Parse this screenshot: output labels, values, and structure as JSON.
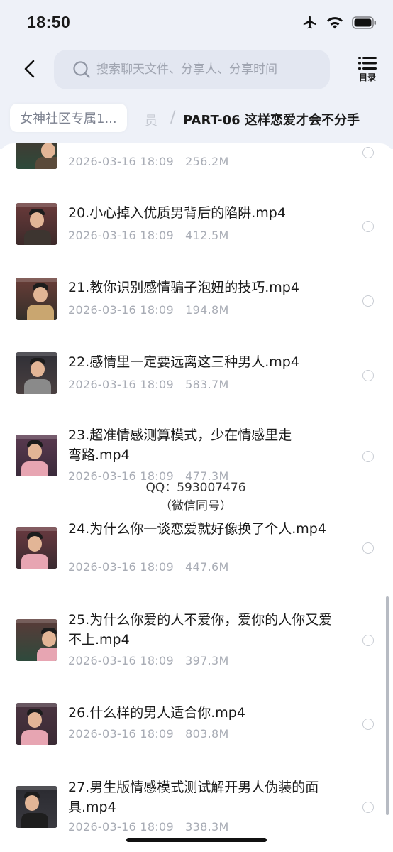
{
  "status_bar": {
    "time": "18:50"
  },
  "search": {
    "placeholder": "搜索聊天文件、分享人、分享时间"
  },
  "toc": {
    "label": "目录"
  },
  "breadcrumb": {
    "first": "女神社区专属1...",
    "hidden_partial": "员",
    "separator": "/",
    "current": "PART-06 这样恋爱才会不分手"
  },
  "files": [
    {
      "title": "",
      "date": "2026-03-16 18:09",
      "size": "256.2M"
    },
    {
      "title": "20.小心掉入优质男背后的陷阱.mp4",
      "date": "2026-03-16 18:09",
      "size": "412.5M"
    },
    {
      "title": "21.教你识别感情骗子泡妞的技巧.mp4",
      "date": "2026-03-16 18:09",
      "size": "194.8M"
    },
    {
      "title": "22.感情里一定要远离这三种男人.mp4",
      "date": "2026-03-16 18:09",
      "size": "583.7M"
    },
    {
      "title": "23.超准情感测算模式，少在情感里走弯路.mp4",
      "date": "2026-03-16 18:09",
      "size": "477.3M"
    },
    {
      "title": "24.为什么你一谈恋爱就好像换了个人.mp4",
      "date": "2026-03-16 18:09",
      "size": "447.6M"
    },
    {
      "title": "25.为什么你爱的人不爱你，爱你的人你又爱不上.mp4",
      "date": "2026-03-16 18:09",
      "size": "397.3M"
    },
    {
      "title": "26.什么样的男人适合你.mp4",
      "date": "2026-03-16 18:09",
      "size": "803.8M"
    },
    {
      "title": "27.男生版情感模式测试解开男人伪装的面具.mp4",
      "date": "2026-03-16 18:09",
      "size": "338.3M"
    }
  ],
  "watermark": {
    "line1": "QQ：593007476",
    "line2": "（微信同号）"
  },
  "icons": [
    "back-chevron-icon",
    "search-icon",
    "toc-list-icon",
    "airplane-icon",
    "wifi-icon",
    "battery-icon"
  ]
}
